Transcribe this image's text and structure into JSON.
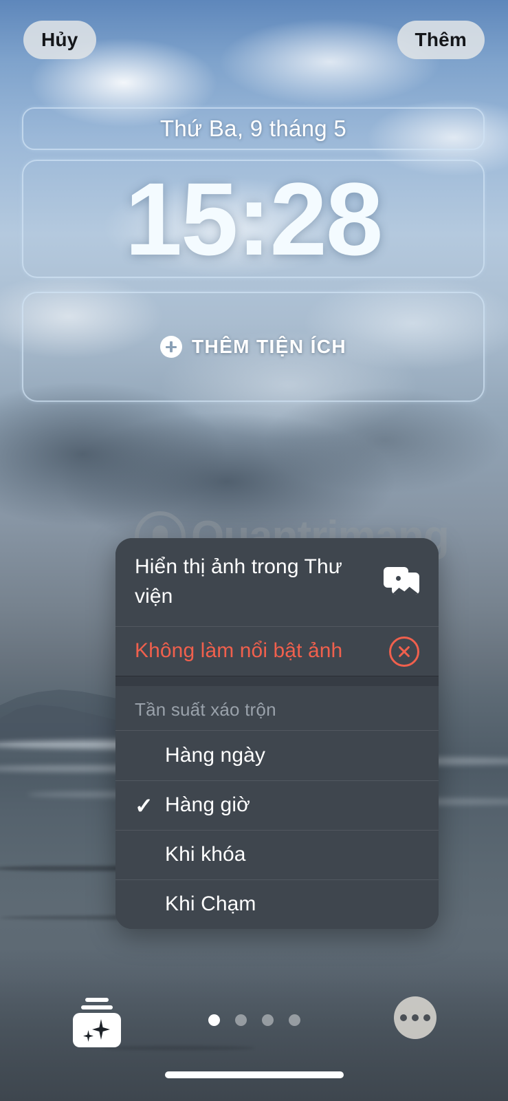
{
  "top_bar": {
    "cancel_label": "Hủy",
    "add_label": "Thêm"
  },
  "lock_screen": {
    "date": "Thứ Ba, 9 tháng 5",
    "time": "15:28",
    "add_widgets_label": "THÊM TIỆN ÍCH"
  },
  "watermark": {
    "text": "Quantrimang",
    "logo_icon": "lightbulb-circle-icon"
  },
  "context_menu": {
    "show_in_library": {
      "label": "Hiển thị ảnh trong Thư viện",
      "icon": "photos-library-icon"
    },
    "unfeature_photo": {
      "label": "Không làm nổi bật ảnh",
      "icon": "x-circle-icon",
      "color": "#f0604d"
    },
    "shuffle_section_header": "Tần suất xáo trộn",
    "options": [
      {
        "label": "Hàng ngày",
        "checked": false
      },
      {
        "label": "Hàng giờ",
        "checked": true
      },
      {
        "label": "Khi khóa",
        "checked": false
      },
      {
        "label": "Khi Chạm",
        "checked": false
      }
    ],
    "checkmark_glyph": "✓"
  },
  "bottom_bar": {
    "shuffle_button_icon": "photo-shuffle-icon",
    "more_button_icon": "ellipsis-icon",
    "page_dots": {
      "count": 4,
      "active_index": 0
    }
  },
  "colors": {
    "menu_background": "#3f464e",
    "destructive": "#f0604d",
    "accent_text": "#ffffff",
    "muted_text": "#9aa2ab"
  }
}
